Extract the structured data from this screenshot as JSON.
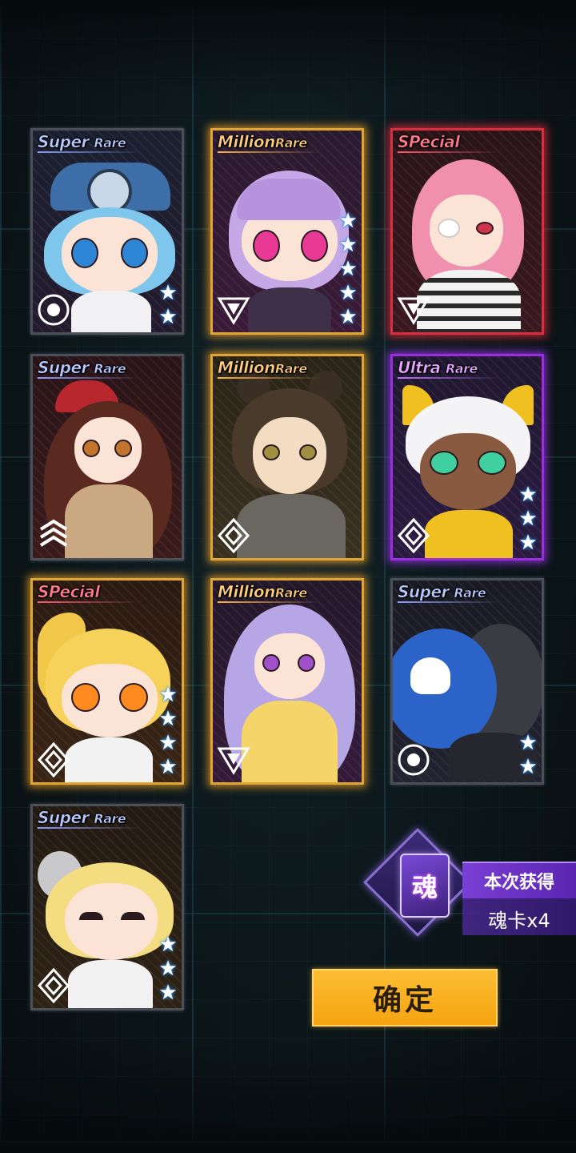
{
  "cards": [
    {
      "rarity_main": "Super",
      "rarity_sub": "Rare",
      "tier": "sr",
      "frame": "silver",
      "type_icon": "circle-crest-icon",
      "stars": 2,
      "character": "blue-hair-mechanic-chibi"
    },
    {
      "rarity_main": "Million",
      "rarity_sub": "Rare",
      "tier": "mr",
      "frame": "gold",
      "type_icon": "triangle-crest-icon",
      "stars": 5,
      "character": "lilac-hair-chibi"
    },
    {
      "rarity_main": "SPecial",
      "rarity_sub": "",
      "tier": "sp",
      "frame": "red",
      "type_icon": "triangle-crest-icon",
      "stars": 0,
      "character": "pink-hair-eyepatch-girl"
    },
    {
      "rarity_main": "Super",
      "rarity_sub": "Rare",
      "tier": "sr",
      "frame": "silver",
      "type_icon": "arrow-crest-icon",
      "stars": 0,
      "character": "brown-hair-beret-girl"
    },
    {
      "rarity_main": "Million",
      "rarity_sub": "Rare",
      "tier": "mr",
      "frame": "gold",
      "type_icon": "diamond-crest-icon",
      "stars": 0,
      "character": "dark-hair-buns-girl"
    },
    {
      "rarity_main": "Ultra",
      "rarity_sub": "Rare",
      "tier": "ur",
      "frame": "purple",
      "type_icon": "diamond-crest-icon",
      "stars": 3,
      "character": "white-hair-cat-chibi"
    },
    {
      "rarity_main": "SPecial",
      "rarity_sub": "",
      "tier": "sp",
      "frame": "gold",
      "type_icon": "diamond-crest-icon",
      "stars": 4,
      "character": "blonde-ponytail-chibi"
    },
    {
      "rarity_main": "Million",
      "rarity_sub": "Rare",
      "tier": "mr",
      "frame": "gold",
      "type_icon": "triangle-crest-icon",
      "stars": 0,
      "character": "lavender-hair-schoolgirl"
    },
    {
      "rarity_main": "Super",
      "rarity_sub": "Rare",
      "tier": "sr",
      "frame": "silver",
      "type_icon": "circle-crest-icon",
      "stars": 2,
      "character": "skull-ball-robot"
    },
    {
      "rarity_main": "Super",
      "rarity_sub": "Rare",
      "tier": "sr",
      "frame": "silver",
      "type_icon": "diamond-crest-icon",
      "stars": 3,
      "character": "blonde-headset-chibi"
    }
  ],
  "soul_reward": {
    "icon_char": "魂",
    "title": "本次获得",
    "count_text": "魂卡x4"
  },
  "confirm_button": {
    "label": "确定"
  },
  "colors": {
    "gold": "#e0a534",
    "red": "#d43040",
    "purple": "#9a2ee0",
    "button": "#f6a410"
  }
}
